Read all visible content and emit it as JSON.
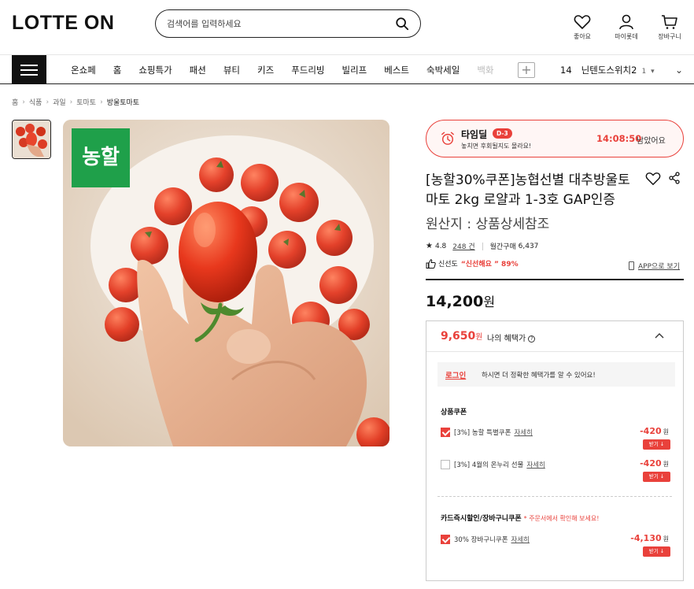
{
  "header": {
    "logo": "LOTTE ON",
    "search_placeholder": "검색어를 입력하세요",
    "icons": [
      {
        "label": "좋아요",
        "icon": "heart-icon"
      },
      {
        "label": "마이롯데",
        "icon": "user-icon"
      },
      {
        "label": "장바구니",
        "icon": "cart-icon"
      }
    ]
  },
  "nav": {
    "items": [
      "온쇼페",
      "홈",
      "쇼핑특가",
      "패션",
      "뷰티",
      "키즈",
      "푸드리빙",
      "빌리프",
      "베스트",
      "숙박세일",
      "백화"
    ],
    "plus_label": "+",
    "rank": {
      "number": "14",
      "keyword": "닌텐도스위치2",
      "change": "1"
    }
  },
  "breadcrumb": [
    "홈",
    "식품",
    "과일",
    "토마토",
    "방울토마토"
  ],
  "timedeal": {
    "title": "타임딜",
    "badge": "D-3",
    "subtitle": "놓치면 후회될지도 몰라요!",
    "time": "14:08:50",
    "suffix": "남았어요"
  },
  "product": {
    "image_logo": "농할",
    "title": "[농할30%쿠폰]농협선별 대추방울토마토 2kg 로얄과 1-3호 GAP인증",
    "origin": "원산지 : 상품상세참조",
    "rating": "4.8",
    "reviews": "248 건",
    "monthly_label": "월간구매",
    "monthly_count": "6,437",
    "freshness_label": "신선도",
    "freshness_value": "“신선해요 ” 89%",
    "app_view": "APP으로 보기",
    "price": "14,200",
    "price_unit": "원"
  },
  "benefit": {
    "price": "9,650",
    "price_unit": "원",
    "label": "나의 혜택가",
    "login_link": "로그인",
    "login_text": "하시면 더 정확한 혜택가를 알 수 있어요!",
    "product_coupon_title": "상품쿠폰",
    "coupons": [
      {
        "name": "[3%] 농할 특별쿠폰",
        "detail": "자세히",
        "amount": "-420",
        "unit": "원",
        "get": "받기",
        "checked": true
      },
      {
        "name": "[3%] 4월의 온누리 선물",
        "detail": "자세히",
        "amount": "-420",
        "unit": "원",
        "get": "받기",
        "checked": false
      }
    ],
    "card_coupon_title": "카드즉시할인/장바구니쿠폰",
    "card_coupon_note": "* 주문서에서 확인해 보세요!",
    "card_coupons": [
      {
        "name": "30% 장바구니쿠폰",
        "detail": "자세히",
        "amount": "-4,130",
        "unit": "원",
        "get": "받기",
        "checked": true
      }
    ]
  },
  "colors": {
    "accent": "#e9413b",
    "nh_green": "#1fa04a"
  }
}
